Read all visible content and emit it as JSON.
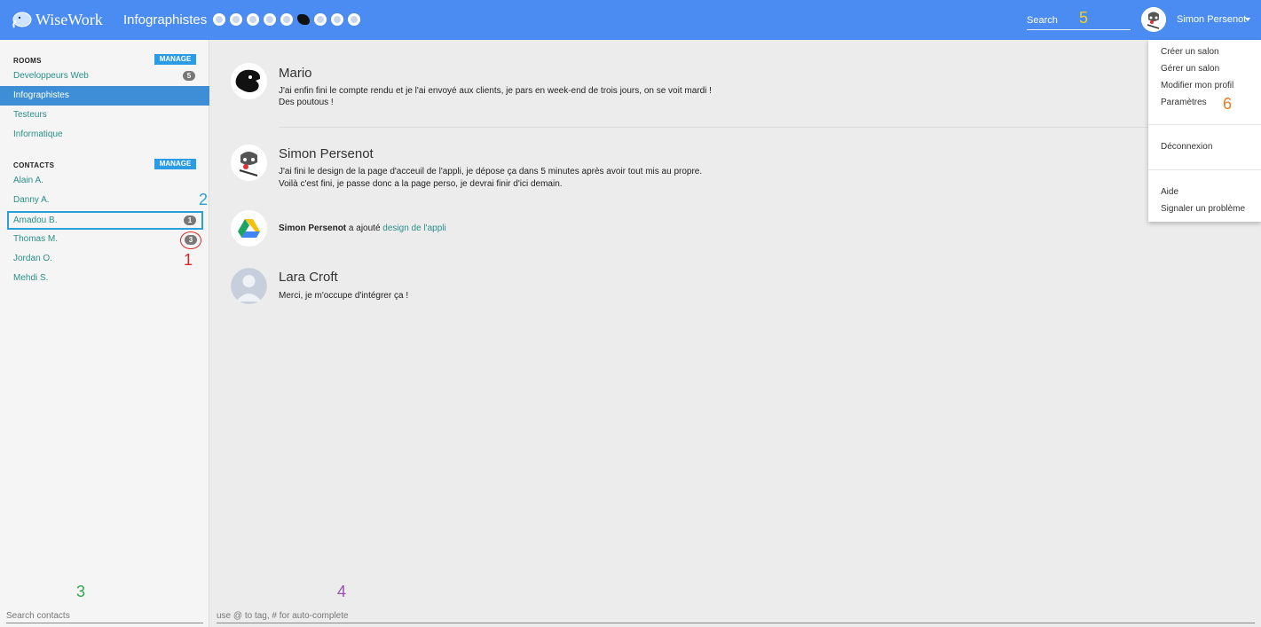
{
  "app": {
    "name": "WiseWork"
  },
  "topbar": {
    "room_title": "Infographistes",
    "search_placeholder": "Search",
    "user_name": "Simon Persenot"
  },
  "sidebar": {
    "rooms_heading": "ROOMS",
    "rooms_manage": "MANAGE",
    "rooms": [
      {
        "label": "Developpeurs Web",
        "badge": "5"
      },
      {
        "label": "Infographistes",
        "active": true
      },
      {
        "label": "Testeurs"
      },
      {
        "label": "Informatique"
      }
    ],
    "contacts_heading": "CONTACTS",
    "contacts_manage": "MANAGE",
    "contacts": [
      {
        "label": "Alain A."
      },
      {
        "label": "Danny A."
      },
      {
        "label": "Amadou B.",
        "badge": "1"
      },
      {
        "label": "Thomas M.",
        "badge": "3"
      },
      {
        "label": "Jordan O."
      },
      {
        "label": "Mehdi S."
      }
    ],
    "search_placeholder": "Search contacts"
  },
  "messages": [
    {
      "author": "Mario",
      "lines": [
        "J'ai enfin fini le compte rendu et je l'ai envoyé aux clients, je pars en week-end de trois jours, on se voit mardi !",
        "Des poutous !"
      ]
    },
    {
      "author": "Simon Persenot",
      "lines": [
        "J'ai fini le design de la page d'acceuil de l'appli, je dépose ça dans 5 minutes après avoir tout mis au propre.",
        "Voilà c'est fini, je passe donc a la page perso, je devrai finir d'ici demain."
      ]
    },
    {
      "event_actor": "Simon Persenot",
      "event_text": " a ajouté ",
      "event_link": "design de l'appli"
    },
    {
      "author": "Lara Croft",
      "lines": [
        "Merci, je m'occupe d'intégrer ça !"
      ]
    }
  ],
  "compose": {
    "placeholder": "use @ to tag, # for auto-complete"
  },
  "dropdown": {
    "items": [
      "Créer un salon",
      "Gérer un salon",
      "Modifier mon profil",
      "Paramètres"
    ],
    "logout": "Déconnexion",
    "help": "Aide",
    "report": "Signaler un problème"
  },
  "annotations": {
    "n1": "1",
    "n2": "2",
    "n3": "3",
    "n4": "4",
    "n5": "5",
    "n6": "6",
    "colors": {
      "n1": "#d62828",
      "n2": "#2aa0da",
      "n3": "#2eaa4a",
      "n4": "#9b4fb0",
      "n5": "#f0d020",
      "n6": "#f07820"
    }
  },
  "colors": {
    "accent": "#4a8cf2",
    "active_room": "#3d8ed6",
    "link": "#2a8f8a",
    "manage": "#2a9be5"
  },
  "icons": {
    "member_avatars": [
      "avatar-icon",
      "avatar-icon",
      "avatar-icon",
      "avatar-icon",
      "avatar-icon",
      "mario-icon",
      "avatar-icon",
      "avatar-icon",
      "avatar-icon"
    ]
  }
}
